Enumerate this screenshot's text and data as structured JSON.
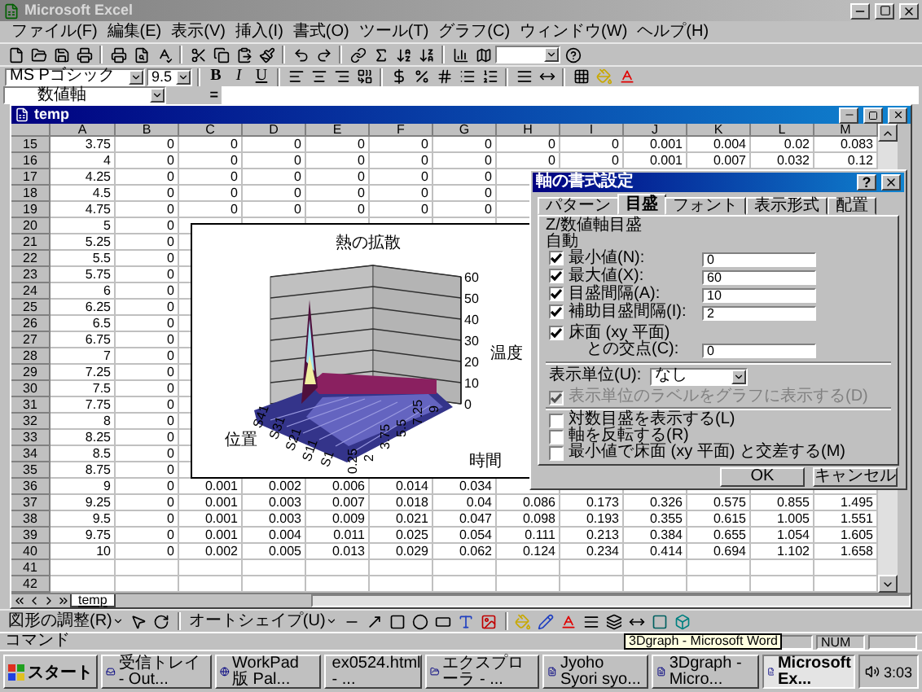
{
  "app_window": {
    "title": "Microsoft Excel"
  },
  "menu": [
    "ファイル(F)",
    "編集(E)",
    "表示(V)",
    "挿入(I)",
    "書式(O)",
    "ツール(T)",
    "グラフ(C)",
    "ウィンドウ(W)",
    "ヘルプ(H)"
  ],
  "formatting_toolbar": {
    "font": "MS Pゴシック",
    "size": "9.5",
    "styles": [
      "B",
      "I",
      "U"
    ]
  },
  "formula_bar": {
    "name_box": "数値軸",
    "equals": "="
  },
  "workbook": {
    "title": "temp",
    "columns": [
      "A",
      "B",
      "C",
      "D",
      "E",
      "F",
      "G",
      "H",
      "I",
      "J",
      "K",
      "L",
      "M"
    ],
    "rows": [
      {
        "num": "15",
        "cells": [
          "3.75",
          "0",
          "0",
          "0",
          "0",
          "0",
          "0",
          "0",
          "0",
          "0.001",
          "0.004",
          "0.02",
          "0.083"
        ]
      },
      {
        "num": "16",
        "cells": [
          "4",
          "0",
          "0",
          "0",
          "0",
          "0",
          "0",
          "0",
          "0",
          "0.001",
          "0.007",
          "0.032",
          "0.12"
        ]
      },
      {
        "num": "17",
        "cells": [
          "4.25",
          "0",
          "0",
          "0",
          "0",
          "0",
          "0"
        ]
      },
      {
        "num": "18",
        "cells": [
          "4.5",
          "0",
          "0",
          "0",
          "0",
          "0",
          "0"
        ]
      },
      {
        "num": "19",
        "cells": [
          "4.75",
          "0",
          "0",
          "0",
          "0",
          "0",
          "0"
        ]
      },
      {
        "num": "20",
        "cells": [
          "5",
          "0"
        ]
      },
      {
        "num": "21",
        "cells": [
          "5.25",
          "0"
        ]
      },
      {
        "num": "22",
        "cells": [
          "5.5",
          "0"
        ]
      },
      {
        "num": "23",
        "cells": [
          "5.75",
          "0"
        ]
      },
      {
        "num": "24",
        "cells": [
          "6",
          "0"
        ]
      },
      {
        "num": "25",
        "cells": [
          "6.25",
          "0"
        ]
      },
      {
        "num": "26",
        "cells": [
          "6.5",
          "0"
        ]
      },
      {
        "num": "27",
        "cells": [
          "6.75",
          "0"
        ]
      },
      {
        "num": "28",
        "cells": [
          "7",
          "0"
        ]
      },
      {
        "num": "29",
        "cells": [
          "7.25",
          "0"
        ]
      },
      {
        "num": "30",
        "cells": [
          "7.5",
          "0"
        ]
      },
      {
        "num": "31",
        "cells": [
          "7.75",
          "0"
        ]
      },
      {
        "num": "32",
        "cells": [
          "8",
          "0"
        ]
      },
      {
        "num": "33",
        "cells": [
          "8.25",
          "0"
        ]
      },
      {
        "num": "34",
        "cells": [
          "8.5",
          "0"
        ]
      },
      {
        "num": "35",
        "cells": [
          "8.75",
          "0"
        ]
      },
      {
        "num": "36",
        "cells": [
          "9",
          "0",
          "0.001",
          "0.002",
          "0.006",
          "0.014",
          "0.034"
        ]
      },
      {
        "num": "37",
        "cells": [
          "9.25",
          "0",
          "0.001",
          "0.003",
          "0.007",
          "0.018",
          "0.04",
          "0.086",
          "0.173",
          "0.326",
          "0.575",
          "0.855",
          "1.495"
        ]
      },
      {
        "num": "38",
        "cells": [
          "9.5",
          "0",
          "0.001",
          "0.003",
          "0.009",
          "0.021",
          "0.047",
          "0.098",
          "0.193",
          "0.355",
          "0.615",
          "1.005",
          "1.551"
        ]
      },
      {
        "num": "39",
        "cells": [
          "9.75",
          "0",
          "0.001",
          "0.004",
          "0.011",
          "0.025",
          "0.054",
          "0.111",
          "0.213",
          "0.384",
          "0.655",
          "1.054",
          "1.605"
        ]
      },
      {
        "num": "40",
        "cells": [
          "10",
          "0",
          "0.002",
          "0.005",
          "0.013",
          "0.029",
          "0.062",
          "0.124",
          "0.234",
          "0.414",
          "0.694",
          "1.102",
          "1.658"
        ]
      },
      {
        "num": "41",
        "cells": []
      },
      {
        "num": "42",
        "cells": []
      }
    ],
    "sheet_tabs": [
      {
        "label": "temp",
        "selected": true
      }
    ]
  },
  "chart": {
    "title": "熱の拡散",
    "z_axis_title": "温度",
    "z_ticks": [
      "60",
      "50",
      "40",
      "30",
      "20",
      "10",
      "0"
    ],
    "depth_axis_title": "位置",
    "depth_ticks": [
      "S1",
      "S11",
      "S21",
      "S31",
      "S41"
    ],
    "x_axis_title": "時間",
    "x_ticks": [
      "0.25",
      "2",
      "3.75",
      "5.5",
      "7.25",
      "9"
    ]
  },
  "dialog": {
    "title": "軸の書式設定",
    "help": "?",
    "tabs": [
      {
        "label": "パターン",
        "selected": false
      },
      {
        "label": "目盛",
        "selected": true
      },
      {
        "label": "フォント",
        "selected": false
      },
      {
        "label": "表示形式",
        "selected": false
      },
      {
        "label": "配置",
        "selected": false
      }
    ],
    "section": "Z/数値軸目盛",
    "auto_label": "自動",
    "scale_fields": [
      {
        "label": "最小値(N):",
        "checked": true,
        "value": "0"
      },
      {
        "label": "最大値(X):",
        "checked": true,
        "value": "60"
      },
      {
        "label": "目盛間隔(A):",
        "checked": true,
        "value": "10"
      },
      {
        "label": "補助目盛間隔(I):",
        "checked": true,
        "value": "2"
      },
      {
        "label": "床面 (xy 平面)",
        "label_line_2": "との交点(C):",
        "checked": true,
        "value": "0"
      }
    ],
    "display_units": {
      "label": "表示単位(U):",
      "value": "なし",
      "show_label": {
        "label": "表示単位のラベルをグラフに表示する(D)",
        "checked": true,
        "disabled": true
      }
    },
    "options": [
      {
        "label": "対数目盛を表示する(L)",
        "checked": false
      },
      {
        "label": "軸を反転する(R)",
        "checked": false
      },
      {
        "label": "最小値で床面 (xy 平面) と交差する(M)",
        "checked": false
      }
    ],
    "buttons": [
      "OK",
      "キャンセル"
    ]
  },
  "drawing_toolbar": {
    "draw_menu": "図形の調整(R)",
    "autoshapes_menu": "オートシェイプ(U)"
  },
  "status_bar": {
    "mode": "コマンド",
    "num_lock": "NUM"
  },
  "taskbar": {
    "start": "スタート",
    "items": [
      {
        "label": "受信トレイ - Out...",
        "selected": false
      },
      {
        "label": "WorkPad 版 Pal...",
        "selected": false
      },
      {
        "label": "ex0524.html - ...",
        "selected": false
      },
      {
        "label": "エクスプローラ - ...",
        "selected": false
      },
      {
        "label": "Jyoho Syori syo...",
        "selected": false
      },
      {
        "label": "3Dgraph - Micro...",
        "selected": false
      },
      {
        "label": "Microsoft Ex...",
        "selected": true
      }
    ],
    "clock": "3:03"
  },
  "tooltip": "3Dgraph - Microsoft Word"
}
